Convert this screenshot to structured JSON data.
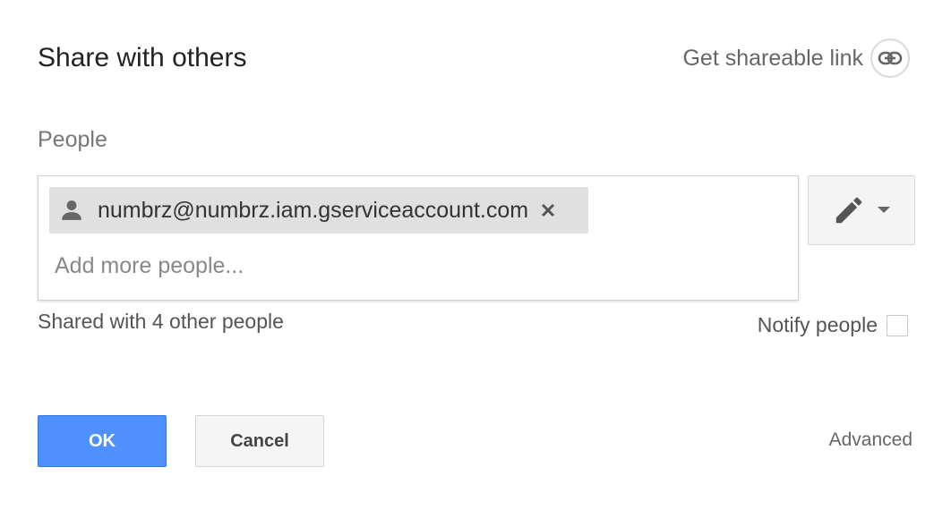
{
  "dialog": {
    "title": "Share with others",
    "shareable_link_label": "Get shareable link"
  },
  "people": {
    "label": "People",
    "chips": [
      {
        "email": "numbrz@numbrz.iam.gserviceaccount.com",
        "icon": "person-icon"
      }
    ],
    "input_placeholder": "Add more people...",
    "input_value": "",
    "permission_icon": "pencil-icon"
  },
  "status": {
    "shared_with": "Shared with 4 other people",
    "notify_label": "Notify people",
    "notify_checked": false
  },
  "actions": {
    "ok_label": "OK",
    "cancel_label": "Cancel",
    "advanced_label": "Advanced"
  },
  "colors": {
    "primary": "#4d90fe",
    "chip_bg": "#e0e0e0",
    "icon_gray": "#666666"
  }
}
